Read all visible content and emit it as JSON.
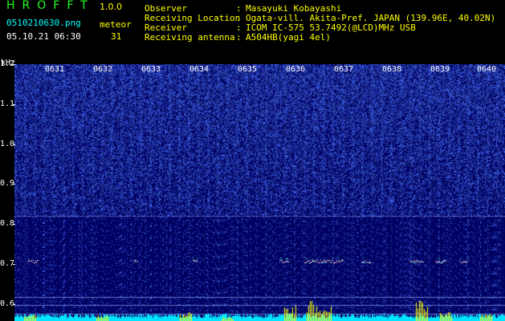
{
  "header": {
    "app_title": "HROFFT",
    "app_version": "1.0.0",
    "file_name": "0510210630.png",
    "meteor_label": "meteor",
    "date_time": "05.10.21 06:30",
    "meteor_count": "31"
  },
  "info": [
    {
      "key": "Observer",
      "value": "Masayuki Kobayashi"
    },
    {
      "key": "Receiving Location",
      "value": "Ogata-vill. Akita-Pref. JAPAN (139.96E, 40.02N)"
    },
    {
      "key": "Receiver",
      "value": "ICOM IC-575 53.7492(@LCD)MHz USB"
    },
    {
      "key": "Receiving antenna",
      "value": "A504HB(yagi 4el)"
    }
  ],
  "info_separator": ":",
  "spectrogram": {
    "unit_label": "kHz",
    "minute_labels": [
      "0631",
      "0632",
      "0633",
      "0634",
      "0635",
      "0636",
      "0637",
      "0638",
      "0639",
      "0640"
    ],
    "freq_labels": [
      "1.2",
      "1.1",
      "1.0",
      "0.9",
      "0.8",
      "0.7",
      "0.6"
    ],
    "freq_range_khz": [
      0.58,
      1.24
    ],
    "beacon_khz": 0.82,
    "colors": {
      "background": "#000060",
      "noise": "#3355ff",
      "signal": "#ff5577",
      "histogram_cyan": "#00e5ff",
      "histogram_yellow": "#ffff00"
    }
  }
}
